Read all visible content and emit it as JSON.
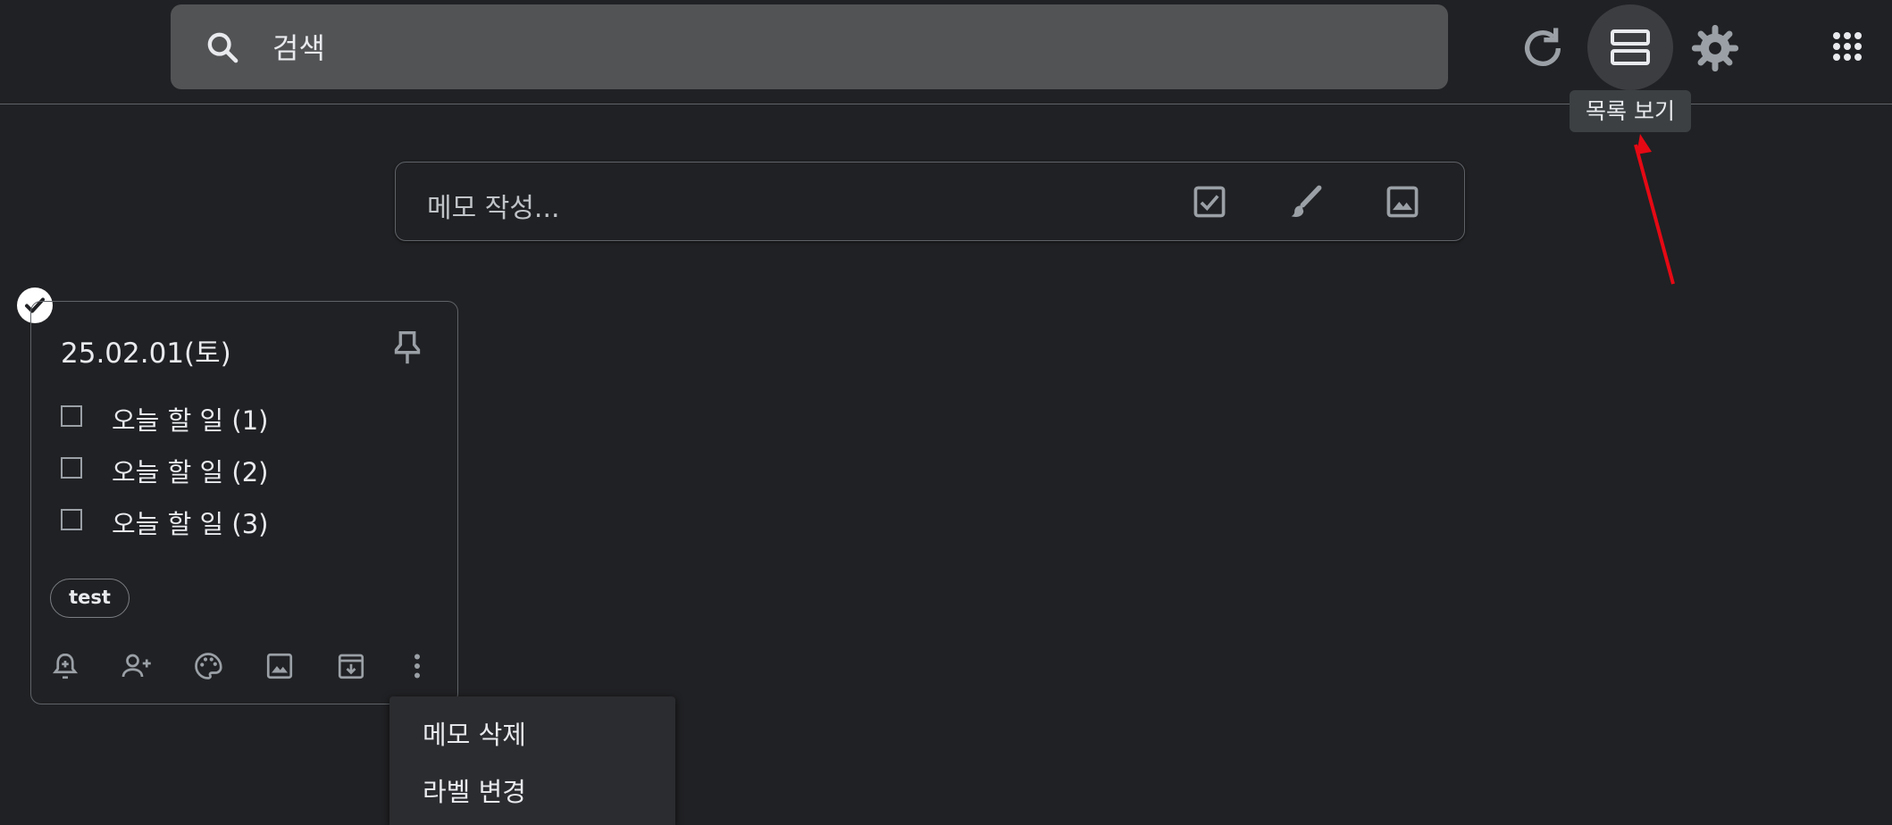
{
  "search": {
    "placeholder": "검색",
    "icon": "search-icon"
  },
  "toolbar": {
    "refresh_icon": "refresh-icon",
    "view_icon": "list-view-icon",
    "settings_icon": "gear-icon",
    "apps_icon": "apps-grid-icon",
    "tooltip": "목록 보기"
  },
  "composer": {
    "placeholder": "메모 작성...",
    "icons": [
      "checkbox-icon",
      "brush-icon",
      "image-icon"
    ]
  },
  "note": {
    "title": "25.02.01(토)",
    "items": [
      {
        "text": "오늘 할 일 (1)",
        "checked": false
      },
      {
        "text": "오늘 할 일 (2)",
        "checked": false
      },
      {
        "text": "오늘 할 일 (3)",
        "checked": false
      }
    ],
    "label": "test",
    "actions": [
      "reminder-icon",
      "collaborator-icon",
      "palette-icon",
      "image-icon",
      "archive-icon",
      "more-icon"
    ]
  },
  "menu": {
    "items": [
      "메모 삭제",
      "라벨 변경"
    ]
  },
  "colors": {
    "background": "#202124",
    "accent_arrow": "#e50914"
  }
}
